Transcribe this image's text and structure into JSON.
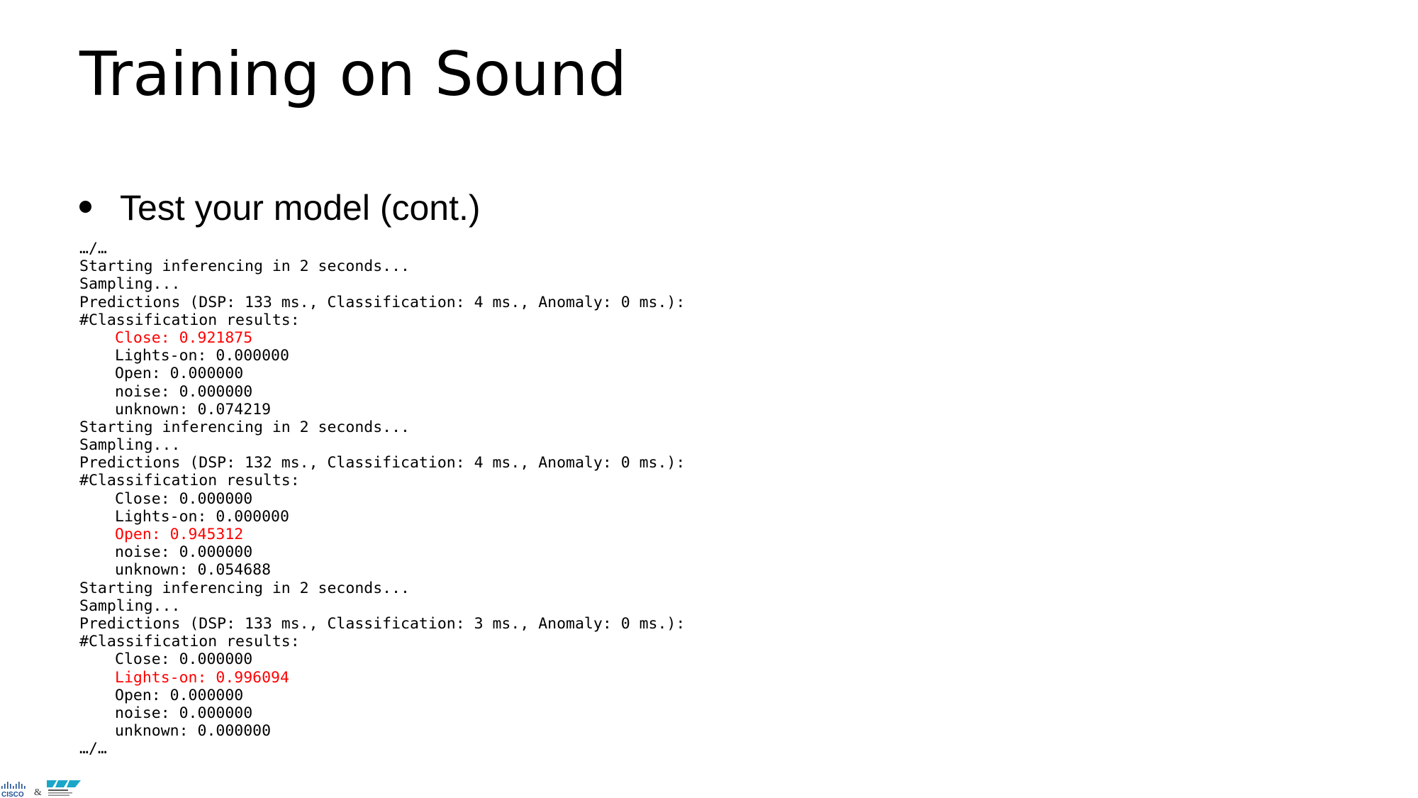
{
  "slide": {
    "title": "Training on Sound",
    "bullet": "Test your model (cont.)"
  },
  "console": {
    "lines": [
      {
        "text": "…/…",
        "indent": false,
        "highlight": false
      },
      {
        "text": "Starting inferencing in 2 seconds...",
        "indent": false,
        "highlight": false
      },
      {
        "text": "Sampling...",
        "indent": false,
        "highlight": false
      },
      {
        "text": "Predictions (DSP: 133 ms., Classification: 4 ms., Anomaly: 0 ms.):",
        "indent": false,
        "highlight": false
      },
      {
        "text": "#Classification results:",
        "indent": false,
        "highlight": false
      },
      {
        "text": "Close: 0.921875",
        "indent": true,
        "highlight": true
      },
      {
        "text": "Lights-on: 0.000000",
        "indent": true,
        "highlight": false
      },
      {
        "text": "Open: 0.000000",
        "indent": true,
        "highlight": false
      },
      {
        "text": "noise: 0.000000",
        "indent": true,
        "highlight": false
      },
      {
        "text": "unknown: 0.074219",
        "indent": true,
        "highlight": false
      },
      {
        "text": "Starting inferencing in 2 seconds...",
        "indent": false,
        "highlight": false
      },
      {
        "text": "Sampling...",
        "indent": false,
        "highlight": false
      },
      {
        "text": "Predictions (DSP: 132 ms., Classification: 4 ms., Anomaly: 0 ms.):",
        "indent": false,
        "highlight": false
      },
      {
        "text": "#Classification results:",
        "indent": false,
        "highlight": false
      },
      {
        "text": "Close: 0.000000",
        "indent": true,
        "highlight": false
      },
      {
        "text": "Lights-on: 0.000000",
        "indent": true,
        "highlight": false
      },
      {
        "text": "Open: 0.945312",
        "indent": true,
        "highlight": true
      },
      {
        "text": "noise: 0.000000",
        "indent": true,
        "highlight": false
      },
      {
        "text": "unknown: 0.054688",
        "indent": true,
        "highlight": false
      },
      {
        "text": "Starting inferencing in 2 seconds...",
        "indent": false,
        "highlight": false
      },
      {
        "text": "Sampling...",
        "indent": false,
        "highlight": false
      },
      {
        "text": "Predictions (DSP: 133 ms., Classification: 3 ms., Anomaly: 0 ms.):",
        "indent": false,
        "highlight": false
      },
      {
        "text": "#Classification results:",
        "indent": false,
        "highlight": false
      },
      {
        "text": "Close: 0.000000",
        "indent": true,
        "highlight": false
      },
      {
        "text": "Lights-on: 0.996094",
        "indent": true,
        "highlight": true
      },
      {
        "text": "Open: 0.000000",
        "indent": true,
        "highlight": false
      },
      {
        "text": "noise: 0.000000",
        "indent": true,
        "highlight": false
      },
      {
        "text": "unknown: 0.000000",
        "indent": true,
        "highlight": false
      },
      {
        "text": "…/…",
        "indent": false,
        "highlight": false
      }
    ]
  },
  "footer": {
    "logo_icons": [
      "cisco-logo-icon",
      "partner-logo-icon"
    ],
    "highlight_color": "#ff0000"
  }
}
